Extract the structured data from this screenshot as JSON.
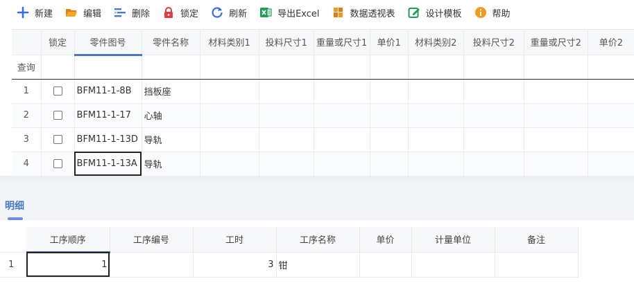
{
  "toolbar": {
    "buttons": [
      {
        "label": "新建",
        "icon": "plus-icon",
        "color": "#2f6fe6"
      },
      {
        "label": "编辑",
        "icon": "folder-open-icon",
        "color": "#f39a1e"
      },
      {
        "label": "删除",
        "icon": "list-remove-icon",
        "color": "#4a78c8"
      },
      {
        "label": "锁定",
        "icon": "lock-icon",
        "color": "#e23b3b"
      },
      {
        "label": "刷新",
        "icon": "refresh-icon",
        "color": "#2f6fe6"
      },
      {
        "label": "导出Excel",
        "icon": "excel-icon",
        "color": "#1f9d55"
      },
      {
        "label": "数据透视表",
        "icon": "pivot-table-icon",
        "color": "#f39a1e"
      },
      {
        "label": "设计模板",
        "icon": "design-template-icon",
        "color": "#1f9d55"
      },
      {
        "label": "帮助",
        "icon": "help-icon",
        "color": "#f39a1e"
      }
    ]
  },
  "main_grid": {
    "columns": [
      "锁定",
      "零件图号",
      "零件名称",
      "材料类别1",
      "投料尺寸1",
      "重量或尺寸1",
      "单价1",
      "材料类别2",
      "投料尺寸2",
      "重量或尺寸2",
      "单价2"
    ],
    "filter_label": "查询",
    "rows": [
      {
        "no": "1",
        "part_no": "BFM11-1-8B",
        "part_name": "挡板座"
      },
      {
        "no": "2",
        "part_no": "BFM11-1-17",
        "part_name": "心轴"
      },
      {
        "no": "3",
        "part_no": "BFM11-1-13D",
        "part_name": "导轨"
      },
      {
        "no": "4",
        "part_no": "BFM11-1-13A",
        "part_name": "导轨"
      }
    ]
  },
  "detail": {
    "title": "明细",
    "columns": [
      "工序顺序",
      "工序编号",
      "工时",
      "工序名称",
      "单价",
      "计量单位",
      "备注"
    ],
    "rows": [
      {
        "no": "1",
        "seq": "1",
        "code": "",
        "hours": "3",
        "name": "钳",
        "price": "",
        "unit": "",
        "remark": ""
      }
    ]
  },
  "accent_color": "#4a78c8"
}
